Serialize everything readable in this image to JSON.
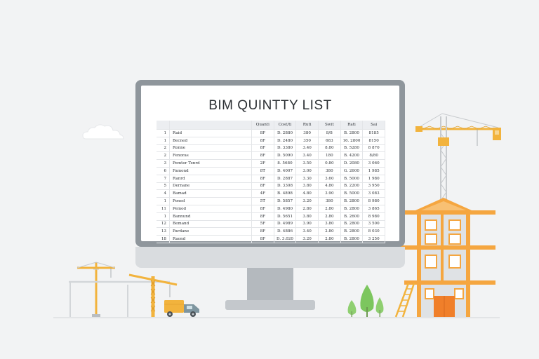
{
  "document": {
    "title": "BIM QUINTTY LIST"
  },
  "table": {
    "columns": [
      "",
      "",
      "Quanti",
      "Cost/ti",
      "Ruti",
      "Swit",
      "Rati",
      "Sai"
    ],
    "rows": [
      [
        "1",
        "Raid",
        "8F",
        "D. 2880",
        "380",
        "8/8",
        "B. 2800",
        "8185"
      ],
      [
        "1",
        "Becned",
        "8F",
        "D. 2480",
        "350",
        "683",
        "16. 2800",
        "8150"
      ],
      [
        "2",
        "Ronne",
        "8F",
        "D. 3380",
        "3.40",
        "8.80",
        "B. 5280",
        "8 870"
      ],
      [
        "2",
        "Fenoras",
        "8F",
        "D. 5090",
        "3.40",
        "180",
        "B. 4200",
        "8/80"
      ],
      [
        "3",
        "Pemtor Tenrd",
        "2F",
        "8. 5680",
        "3.50",
        "0.80",
        "D. 2080",
        "3 060"
      ],
      [
        "6",
        "Famond",
        "8T",
        "D. 4007",
        "3.00",
        "380",
        "G. 2600",
        "1 985"
      ],
      [
        "7",
        "Ranrd",
        "8F",
        "D. 2887",
        "3.30",
        "3.60",
        "B. 5000",
        "1 980"
      ],
      [
        "5",
        "Dernane",
        "8F",
        "D. 3308",
        "3.80",
        "4.80",
        "B. 2200",
        "3 950"
      ],
      [
        "4",
        "Bamad",
        "4F",
        "B. 4898",
        "4.80",
        "3.90",
        "B. 5000",
        "3 083"
      ],
      [
        "1",
        "Poned",
        "5T",
        "D. 5857",
        "3.20",
        "380",
        "B. 2800",
        "8 980"
      ],
      [
        "11",
        "Pemod",
        "8F",
        "D. 4980",
        "2.80",
        "2.80",
        "B. 2800",
        "3 865"
      ],
      [
        "1",
        "Bannund",
        "8F",
        "D. 5651",
        "3.80",
        "2.80",
        "B. 2600",
        "8 980"
      ],
      [
        "12",
        "Bemand",
        "5F",
        "D. 4989",
        "3.90",
        "3.80",
        "B. 2800",
        "3 500"
      ],
      [
        "13",
        "Pardane",
        "8F",
        "D. 4886",
        "3.40",
        "2.80",
        "B. 2800",
        "8 030"
      ],
      [
        "18",
        "Raond",
        "8F",
        "D. 3.020",
        "3.20",
        "2.80",
        "B. 2800",
        "3 250"
      ]
    ]
  },
  "palette": {
    "crane": "#f2b33d",
    "crane_lattice": "#c7cacd",
    "building": "#f5a640",
    "door": "#f07f2a",
    "tree": "#8fcf70"
  },
  "icons": {
    "cloud": "cloud-icon",
    "truck": "truck-icon"
  }
}
